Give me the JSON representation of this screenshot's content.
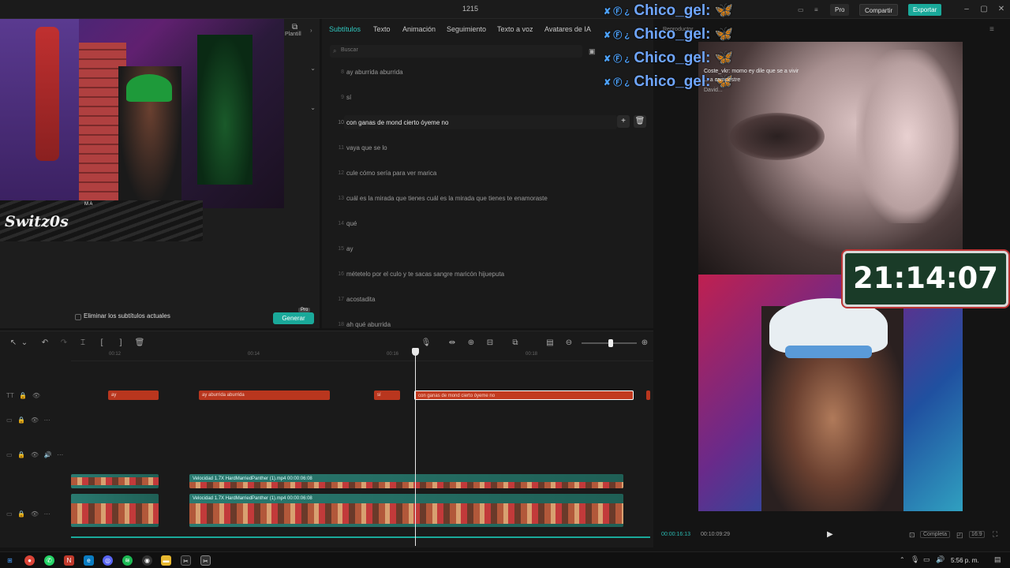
{
  "window": {
    "title": "1215"
  },
  "titlebar": {
    "pro": "Pro",
    "share": "Compartir",
    "export": "Exportar"
  },
  "left": {
    "templates_label": "Plantill",
    "streamer_tag": "Switz0s",
    "overlay_small": "M A",
    "erase_label": "Eliminar los subtítulos actuales",
    "generate_label": "Generar",
    "generate_badge": "Pro"
  },
  "tabs": [
    "Subtítulos",
    "Texto",
    "Animación",
    "Seguimiento",
    "Texto a voz",
    "Avatares de IA"
  ],
  "search": {
    "placeholder": "Buscar"
  },
  "subtitles": [
    {
      "num": "8",
      "text": "ay  aburrida aburrida"
    },
    {
      "num": "9",
      "text": "sí"
    },
    {
      "num": "10",
      "text": "con ganas de mond cierto óyeme no"
    },
    {
      "num": "11",
      "text": "vaya que se lo"
    },
    {
      "num": "12",
      "text": "cule cómo sería para ver marica"
    },
    {
      "num": "13",
      "text": "cuál es la mirada que tienes cuál es la mirada que tienes te enamoraste"
    },
    {
      "num": "14",
      "text": "qué"
    },
    {
      "num": "15",
      "text": "ay"
    },
    {
      "num": "16",
      "text": "métetelo por el culo y te sacas sangre maricón hijueputa"
    },
    {
      "num": "17",
      "text": "acostadita"
    },
    {
      "num": "18",
      "text": "ah qué aburrida"
    }
  ],
  "overlay": {
    "chico_prefix": "✘ Ⓕ ¿",
    "chico_name": "Chico_gel:",
    "player_label": "Reproductor",
    "chat": [
      "Coste_vkr: momo ey dile que se a vivir",
      "... a campestre",
      "David..."
    ],
    "clock": "21:14:07"
  },
  "preview": {
    "current": "00:00:16:13",
    "total": "00:10:09:29",
    "full_label": "Completa",
    "ratio": "16:9"
  },
  "timeline": {
    "ruler": [
      "00:12",
      "00:14",
      "00:16",
      "00:18"
    ],
    "clips": [
      {
        "label": "ay"
      },
      {
        "label": "ay  aburrida aburrida"
      },
      {
        "label": "sí"
      },
      {
        "label": "con ganas de mond cierto óyeme no"
      }
    ],
    "video_tracks": [
      {
        "label": "Velocidad 1.7X   HardMarriedPanther (1).mp4   00:00:06:08"
      },
      {
        "label": "Velocidad 1.7X   HardMarriedPanther (1).mp4   00:00:06:08"
      }
    ]
  },
  "taskbar": {
    "time": "5:56 p. m.",
    "icons": [
      "windows-icon",
      "chrome-icon",
      "whatsapp-icon",
      "news-icon",
      "edge-icon",
      "discord-icon",
      "spotify-icon",
      "obs-icon",
      "folder-icon",
      "capcut-icon",
      "capcut-active-icon"
    ]
  }
}
